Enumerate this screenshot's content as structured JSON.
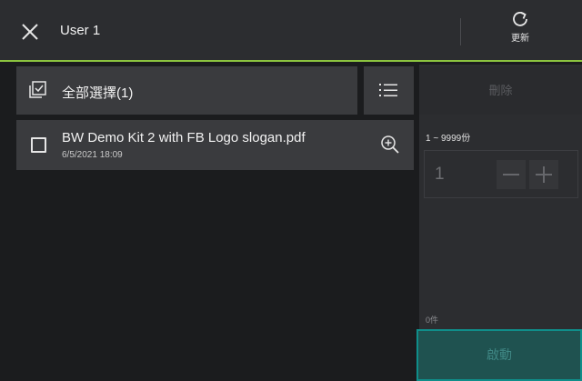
{
  "header": {
    "user": "User 1",
    "refresh_label": "更新",
    "accent_color": "#8cc43f"
  },
  "toolbar": {
    "select_all_label": "全部選擇(1)",
    "delete_label": "刪除"
  },
  "files": [
    {
      "name": "BW Demo Kit 2 with FB Logo slogan.pdf",
      "date": "6/5/2021 18:09"
    }
  ],
  "quantity": {
    "range_label": "1 ~ 9999份",
    "value": "1"
  },
  "count_label": "0件",
  "start_label": "啟動",
  "icons": {
    "close": "close-icon",
    "refresh": "refresh-icon",
    "select_all": "checkbox-checked-icon",
    "list": "list-icon",
    "zoom": "zoom-in-icon"
  }
}
